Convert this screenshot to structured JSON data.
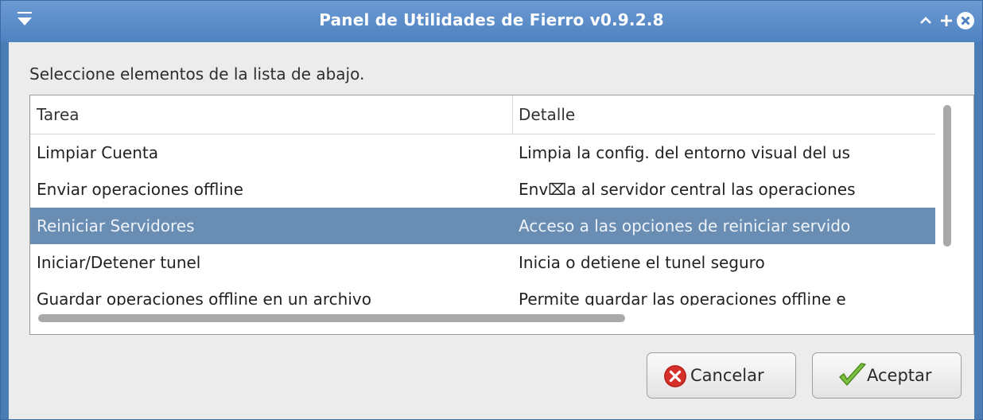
{
  "window": {
    "title": "Panel de Utilidades de Fierro v0.9.2.8",
    "accent": "#4f82c1"
  },
  "instructions": "Seleccione elementos de la lista de abajo.",
  "list": {
    "columns": [
      "Tarea",
      "Detalle"
    ],
    "rows": [
      {
        "task": "Limpiar Cuenta",
        "detail": "Limpia la config. del entorno visual del us"
      },
      {
        "task": "Enviar operaciones offline",
        "detail": "Env⌧a al servidor central las operaciones"
      },
      {
        "task": "Reiniciar Servidores",
        "detail": "Acceso a las opciones de reiniciar servido"
      },
      {
        "task": "Iniciar/Detener tunel",
        "detail": "Inicia o detiene el tunel seguro"
      },
      {
        "task": "Guardar operaciones offline en un archivo",
        "detail": "Permite guardar las operaciones offline e"
      }
    ],
    "selected_index": 2,
    "selection_color": "#6a8db3"
  },
  "buttons": {
    "cancel_label": "Cancelar",
    "accept_label": "Aceptar"
  }
}
